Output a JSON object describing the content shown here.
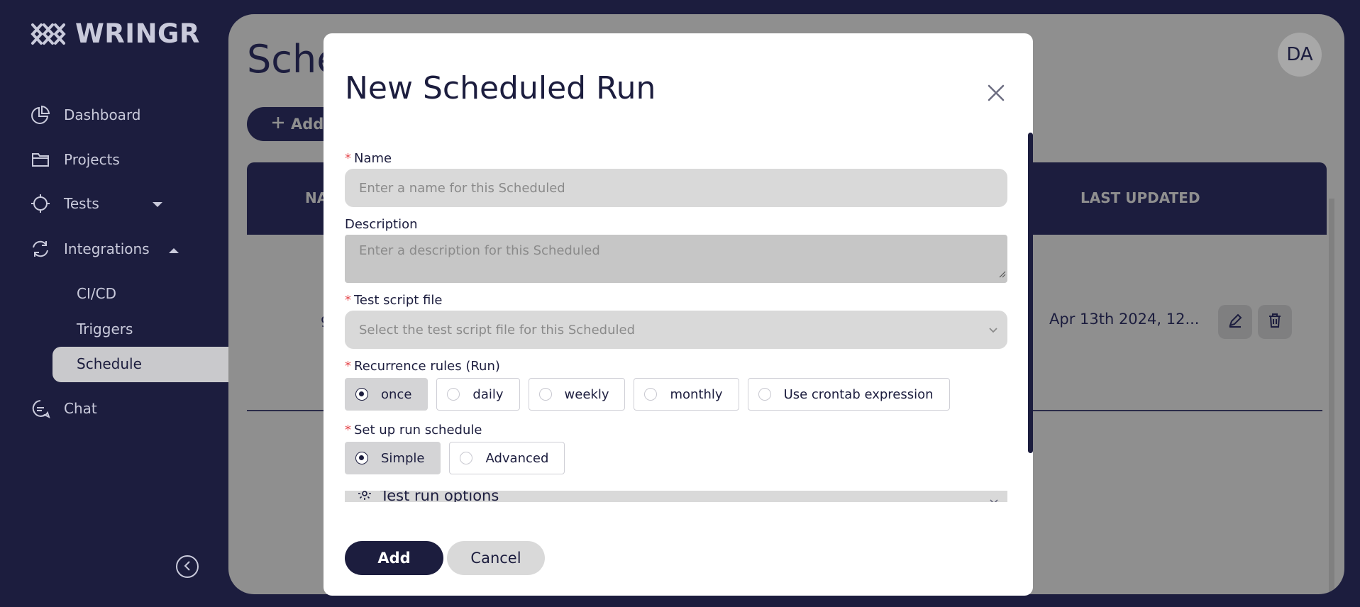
{
  "app": {
    "brand": "WRINGR"
  },
  "sidebar": {
    "items": [
      {
        "label": "Dashboard",
        "icon": "pie-chart-icon"
      },
      {
        "label": "Projects",
        "icon": "folder-icon"
      },
      {
        "label": "Tests",
        "icon": "crosshair-icon"
      },
      {
        "label": "Integrations",
        "icon": "refresh-icon"
      },
      {
        "label": "Chat",
        "icon": "chat-icon"
      }
    ],
    "sub_items": [
      {
        "label": "CI/CD"
      },
      {
        "label": "Triggers"
      },
      {
        "label": "Schedule"
      }
    ]
  },
  "page": {
    "title_visible": "Sche",
    "add_button_visible": "Add",
    "avatar": "DA",
    "table_headers": {
      "name_visible": "NA",
      "last_updated": "LAST UPDATED"
    },
    "row": {
      "name_fragment": "9",
      "last_updated": "Apr 13th 2024, 12..."
    }
  },
  "modal": {
    "title": "New Scheduled Run",
    "fields": {
      "name": {
        "label": "Name",
        "placeholder": "Enter a name for this Scheduled"
      },
      "description": {
        "label": "Description",
        "placeholder": "Enter a description for this Scheduled"
      },
      "script": {
        "label": "Test script file",
        "placeholder": "Select the test script file for this Scheduled"
      },
      "recurrence": {
        "label": "Recurrence rules (Run)",
        "options": [
          "once",
          "daily",
          "weekly",
          "monthly",
          "Use crontab expression"
        ],
        "selected": "once"
      },
      "schedule": {
        "label": "Set up run schedule",
        "options": [
          "Simple",
          "Advanced"
        ],
        "selected": "Simple"
      },
      "options_panel": {
        "label": "Test run options"
      }
    },
    "buttons": {
      "add": "Add",
      "cancel": "Cancel"
    }
  },
  "colors": {
    "navy": "#1c1d3e",
    "required": "#e5484d",
    "overlay": "#8f8f8f"
  }
}
